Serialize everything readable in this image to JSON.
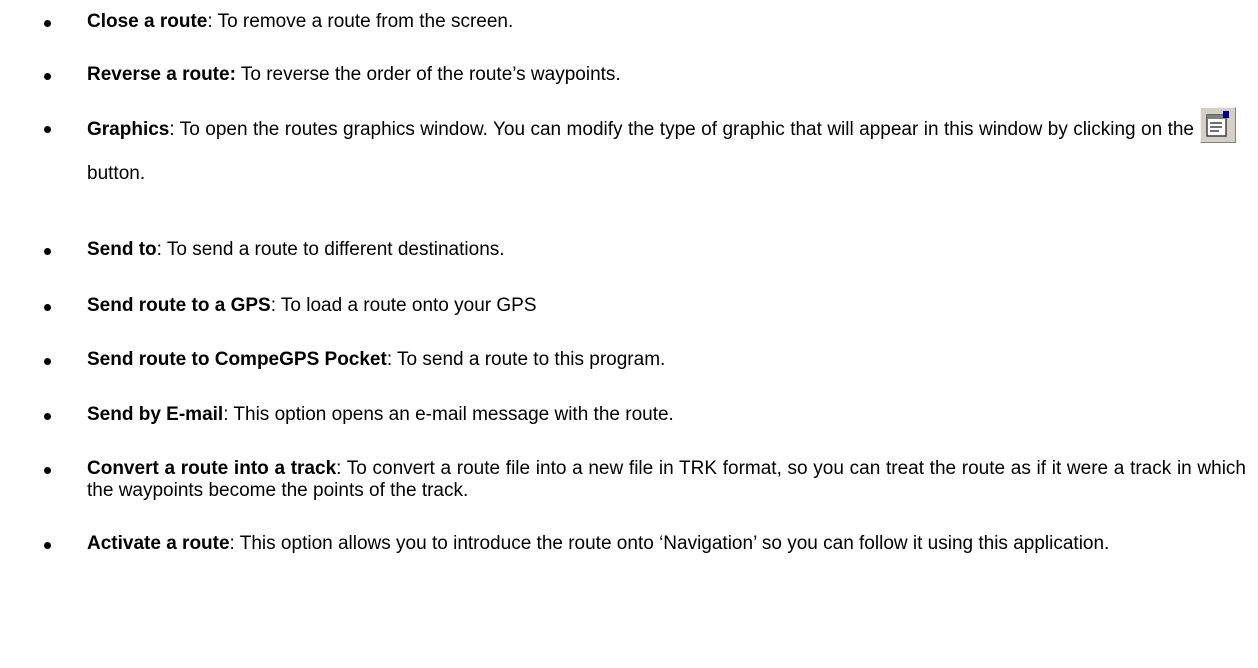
{
  "items": [
    {
      "term": "Close a route",
      "text": ": To remove a route from the screen."
    },
    {
      "term": "Reverse a route:",
      "text": " To reverse the order of the route’s waypoints."
    },
    {
      "term": "Graphics",
      "text_before": ": To open the routes graphics window. You can modify the type of graphic that will appear in this window by clicking on the",
      "icon": "graph-properties-icon",
      "text_after": "button."
    },
    {
      "term": "Send to",
      "text": ": To send a route to different destinations."
    },
    {
      "term": "Send route to a GPS",
      "text": ": To load a route onto your GPS"
    },
    {
      "term": "Send route to CompeGPS Pocket",
      "text": ": To send a route to this program."
    },
    {
      "term": "Send by E-mail",
      "text": ": This option opens an e-mail message with the route."
    },
    {
      "term": "Convert a route into a track",
      "text": ": To convert a route file into a new file in TRK format, so you can treat the route as if it were a track in which the waypoints become the points of the track."
    },
    {
      "term": "Activate a route",
      "text": ": This option allows you to introduce the route onto ‘Navigation’ so you can follow it using this application."
    }
  ]
}
